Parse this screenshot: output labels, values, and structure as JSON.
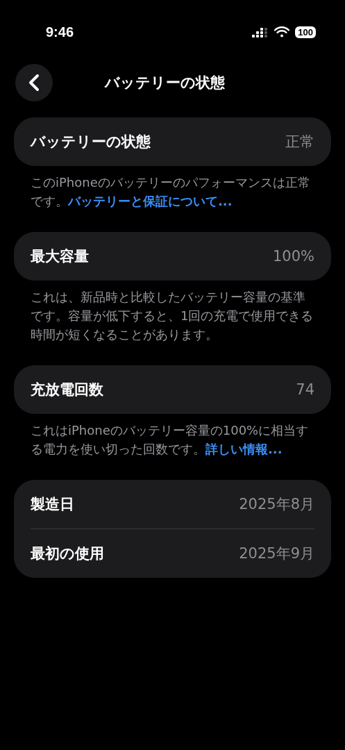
{
  "status_bar": {
    "time": "9:46",
    "battery": "100"
  },
  "nav": {
    "title": "バッテリーの状態"
  },
  "sections": [
    {
      "rows": [
        {
          "label": "バッテリーの状態",
          "value": "正常",
          "bold": true
        }
      ],
      "footnote": {
        "text": "このiPhoneのバッテリーのパフォーマンスは正常です。",
        "link": "バッテリーと保証について..."
      }
    },
    {
      "rows": [
        {
          "label": "最大容量",
          "value": "100%",
          "bold": true
        }
      ],
      "footnote": {
        "text": "これは、新品時と比較したバッテリー容量の基準です。容量が低下すると、1回の充電で使用できる時間が短くなることがあります。"
      }
    },
    {
      "rows": [
        {
          "label": "充放電回数",
          "value": "74",
          "bold": true
        }
      ],
      "footnote": {
        "text": "これはiPhoneのバッテリー容量の100%に相当する電力を使い切った回数です。",
        "link": "詳しい情報..."
      }
    },
    {
      "rows": [
        {
          "label": "製造日",
          "value": "2025年8月",
          "bold": true
        },
        {
          "label": "最初の使用",
          "value": "2025年9月",
          "bold": true
        }
      ]
    }
  ]
}
